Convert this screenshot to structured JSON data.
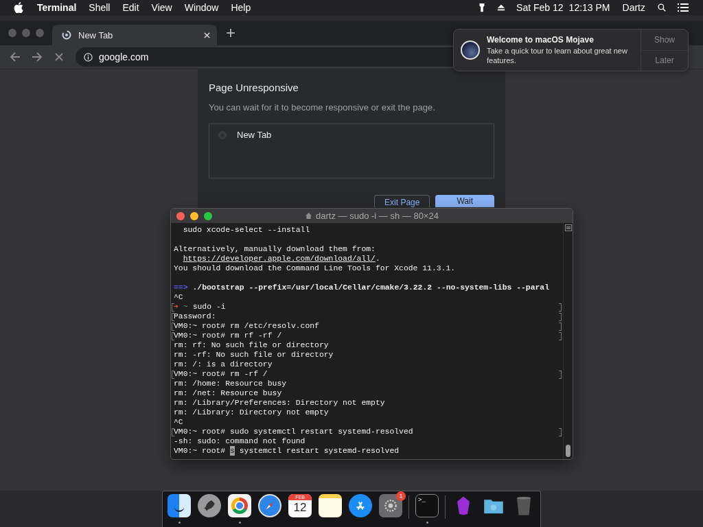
{
  "menu_bar": {
    "app_name": "Terminal",
    "menus": [
      "Shell",
      "Edit",
      "View",
      "Window",
      "Help"
    ],
    "date": "Sat Feb 12",
    "time": "12:13 PM",
    "user": "Dartz"
  },
  "browser": {
    "tab": {
      "title": "New Tab",
      "selected": true
    },
    "address": "google.com",
    "dialog": {
      "title": "Page Unresponsive",
      "message": "You can wait for it to become responsive or exit the page.",
      "page": "New Tab",
      "buttons": [
        {
          "label": "Exit Page",
          "kind": "secondary"
        },
        {
          "label": "Wait",
          "kind": "primary"
        }
      ]
    }
  },
  "notification": {
    "title": "Welcome to macOS Mojave",
    "body": "Take a quick tour to learn about great new features.",
    "actions": [
      "Show",
      "Later"
    ]
  },
  "terminal": {
    "title": "dartz — sudo -i — sh — 80×24",
    "lines": [
      {
        "kind": "plain",
        "text": "  sudo xcode-select --install",
        "marked": false
      },
      {
        "kind": "blank",
        "marked": false
      },
      {
        "kind": "plain",
        "text": "Alternatively, manually download them from:",
        "marked": false
      },
      {
        "kind": "link",
        "link": "https://developer.apple.com/download/all/",
        "text": ".",
        "marked": false
      },
      {
        "kind": "plain",
        "text": "You should download the Command Line Tools for Xcode 11.3.1.",
        "marked": false
      },
      {
        "kind": "blank",
        "marked": false
      },
      {
        "kind": "arrow",
        "prefix": "==>",
        "text": "./bootstrap --prefix=/usr/local/Cellar/cmake/3.22.2 --no-system-libs --paral",
        "marked": false
      },
      {
        "kind": "plain",
        "text": "^C",
        "marked": false
      },
      {
        "kind": "zsh",
        "prefix": "➜",
        "dir": "~",
        "text": "sudo -i",
        "marked": true
      },
      {
        "kind": "plain",
        "text": "Password:",
        "marked": true
      },
      {
        "kind": "plain",
        "text": "VM0:~ root# rm /etc/resolv.conf",
        "marked": true
      },
      {
        "kind": "plain",
        "text": "VM0:~ root# rm rf -rf /",
        "marked": true
      },
      {
        "kind": "plain",
        "text": "rm: rf: No such file or directory",
        "marked": false
      },
      {
        "kind": "plain",
        "text": "rm: -rf: No such file or directory",
        "marked": false
      },
      {
        "kind": "plain",
        "text": "rm: /: is a directory",
        "marked": false
      },
      {
        "kind": "plain",
        "text": "VM0:~ root# rm -rf /",
        "marked": true
      },
      {
        "kind": "plain",
        "text": "rm: /home: Resource busy",
        "marked": false
      },
      {
        "kind": "plain",
        "text": "rm: /net: Resource busy",
        "marked": false
      },
      {
        "kind": "plain",
        "text": "rm: /Library/Preferences: Directory not empty",
        "marked": false
      },
      {
        "kind": "plain",
        "text": "rm: /Library: Directory not empty",
        "marked": false
      },
      {
        "kind": "plain",
        "text": "^C",
        "marked": false
      },
      {
        "kind": "plain",
        "text": "VM0:~ root# sudo systemctl restart systemd-resolved",
        "marked": true
      },
      {
        "kind": "plain",
        "text": "-sh: sudo: command not found",
        "marked": false
      },
      {
        "kind": "cursor",
        "prefix": "VM0:~ root# ",
        "cursor": "s",
        "text": " systemctl restart systemd-resolved",
        "marked": false
      }
    ]
  },
  "dock": {
    "items": [
      {
        "kind": "finder",
        "running": true
      },
      {
        "kind": "launchpad",
        "running": false
      },
      {
        "kind": "chrome",
        "running": true
      },
      {
        "kind": "safari",
        "running": false
      },
      {
        "kind": "calendar",
        "month": "FEB",
        "day": "12",
        "running": false
      },
      {
        "kind": "notes",
        "running": false
      },
      {
        "kind": "appstore",
        "running": false
      },
      {
        "kind": "preferences",
        "badge": "1",
        "running": false
      },
      {
        "kind": "separator"
      },
      {
        "kind": "terminal",
        "glyph": ">_",
        "running": true
      },
      {
        "kind": "separator"
      },
      {
        "kind": "gem",
        "running": false
      },
      {
        "kind": "downloads",
        "running": false
      },
      {
        "kind": "trash",
        "running": false
      }
    ]
  }
}
